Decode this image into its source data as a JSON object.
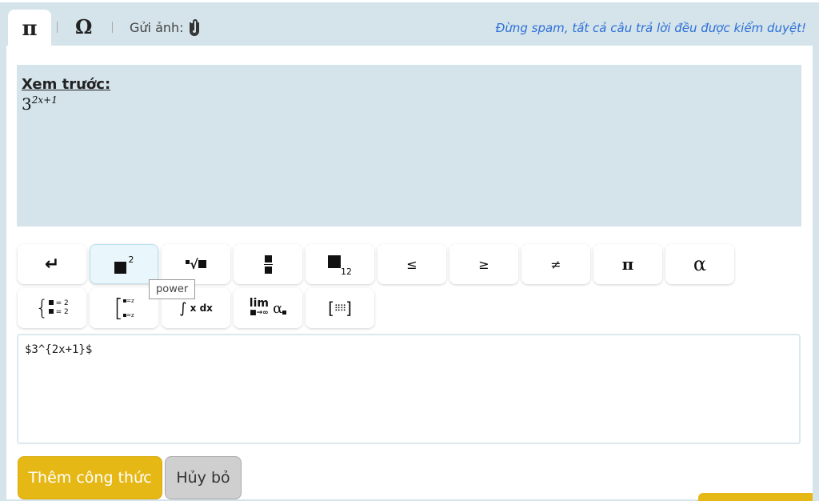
{
  "header": {
    "tab_pi": "π",
    "tab_omega": "Ω",
    "upload_label": "Gửi ảnh:",
    "notice": "Đừng spam, tất cả câu trả lời đều được kiểm duyệt!"
  },
  "preview": {
    "title": "Xem trước:",
    "base": "3",
    "exponent": "2x+1"
  },
  "toolbar": {
    "row1": [
      {
        "name": "newline",
        "label": "↵"
      },
      {
        "name": "power",
        "label": "2"
      },
      {
        "name": "root",
        "label": "√"
      },
      {
        "name": "fraction",
        "label": ""
      },
      {
        "name": "subscript",
        "label": "12"
      },
      {
        "name": "less-equal",
        "label": "≤"
      },
      {
        "name": "greater-equal",
        "label": "≥"
      },
      {
        "name": "not-equal",
        "label": "≠"
      },
      {
        "name": "pi",
        "label": "π"
      },
      {
        "name": "alpha",
        "label": "α"
      }
    ],
    "row2": [
      {
        "name": "system",
        "label": "= 2"
      },
      {
        "name": "bracket-system",
        "label": "=z"
      },
      {
        "name": "integral",
        "label": "x dx"
      },
      {
        "name": "limit",
        "label": "lim"
      },
      {
        "name": "matrix",
        "label": ""
      }
    ],
    "tooltip": "power"
  },
  "editor": {
    "value": "$3^{2x+1}$"
  },
  "actions": {
    "add": "Thêm công thức",
    "cancel": "Hủy bỏ"
  },
  "colors": {
    "accent": "#e6b816",
    "panel": "#d4e4ea",
    "link": "#2d6fd8"
  }
}
